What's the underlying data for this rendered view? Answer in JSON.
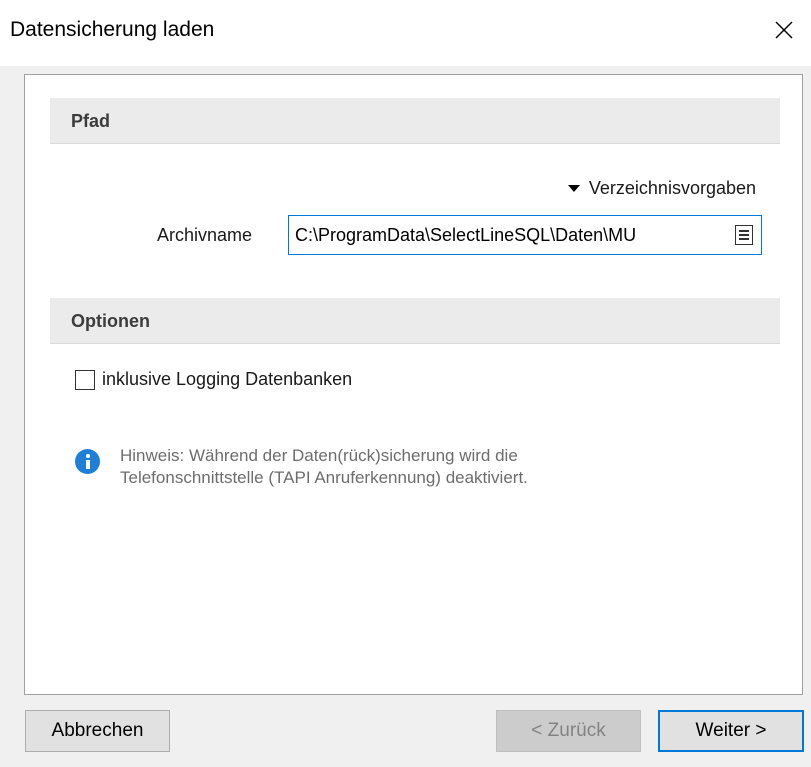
{
  "window": {
    "title": "Datensicherung laden",
    "close_symbol": "✕"
  },
  "sections": {
    "pfad": "Pfad",
    "optionen": "Optionen"
  },
  "path": {
    "directory_link": "Verzeichnisvorgaben",
    "archive_label": "Archivname",
    "archive_value": "C:\\ProgramData\\SelectLineSQL\\Daten\\MU"
  },
  "options": {
    "logging_label": "inklusive Logging Datenbanken",
    "logging_checked": false
  },
  "hint": {
    "line1": "Hinweis: Während der Daten(rück)sicherung wird die",
    "line2": "Telefonschnittstelle (TAPI Anruferkennung) deaktiviert."
  },
  "buttons": {
    "cancel": "Abbrechen",
    "back": "< Zurück",
    "next": "Weiter >"
  },
  "colors": {
    "accent": "#0078d7",
    "info": "#1f7ed6",
    "section_bg": "#ebebeb"
  }
}
